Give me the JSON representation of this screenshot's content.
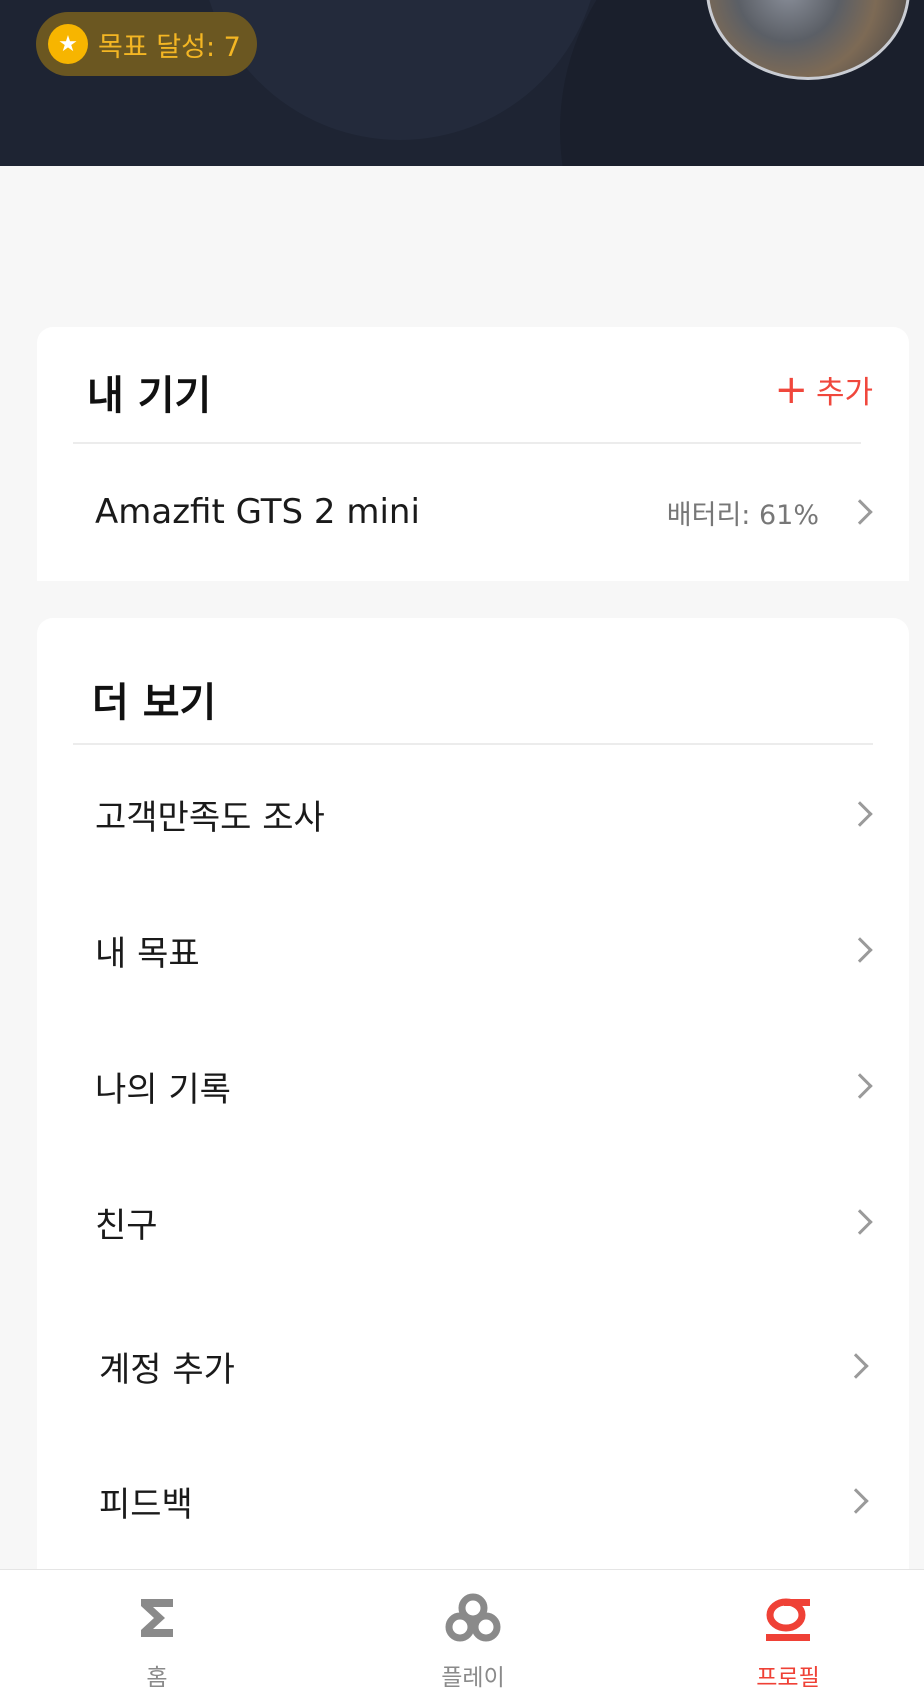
{
  "header": {
    "goal_badge_text": "목표 달성: 7",
    "star_icon": "star-icon",
    "avatar": "profile-avatar"
  },
  "devices": {
    "title": "내 기기",
    "add_label": "추가",
    "add_icon": "plus-icon",
    "items": [
      {
        "name": "Amazfit GTS 2 mini",
        "status": "배터리: 61%"
      }
    ]
  },
  "more": {
    "title": "더 보기",
    "items": [
      {
        "label": "고객만족도 조사"
      },
      {
        "label": "내 목표"
      },
      {
        "label": "나의 기록"
      },
      {
        "label": "친구"
      },
      {
        "label": "계정 추가"
      },
      {
        "label": "피드백"
      }
    ]
  },
  "bottom_nav": {
    "items": [
      {
        "label": "홈",
        "icon": "sigma-icon",
        "active": false
      },
      {
        "label": "플레이",
        "icon": "play-knot-icon",
        "active": false
      },
      {
        "label": "프로필",
        "icon": "profile-icon",
        "active": true
      }
    ]
  },
  "colors": {
    "accent": "#ef4136",
    "header_bg": "#1e2433",
    "badge_bg": "#6b5721",
    "badge_text": "#f4b623",
    "star": "#f7b500"
  }
}
